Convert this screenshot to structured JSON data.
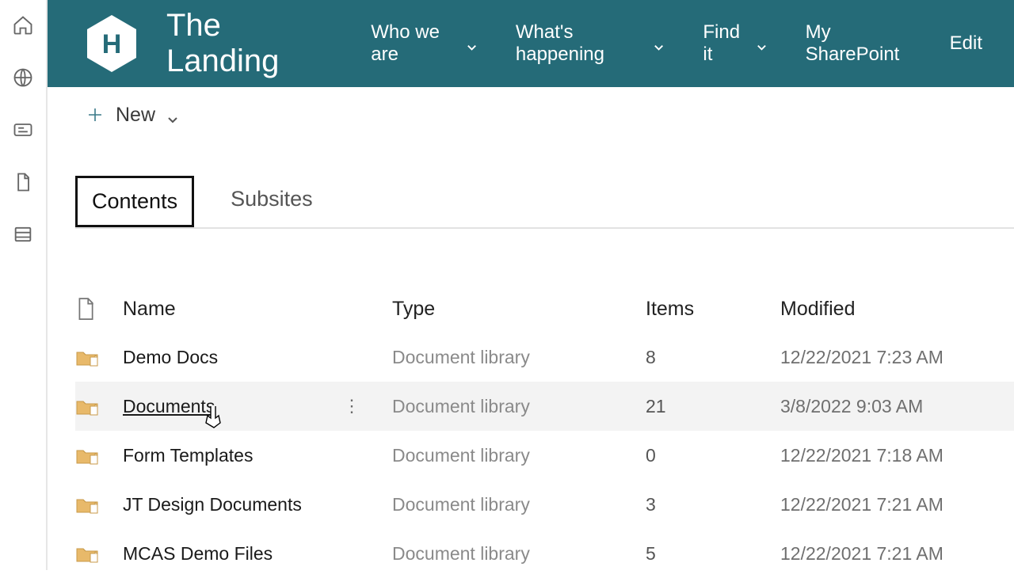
{
  "site": {
    "title": "The Landing"
  },
  "nav": {
    "items": [
      {
        "label": "Who we are",
        "has_dropdown": true
      },
      {
        "label": "What's happening",
        "has_dropdown": true
      },
      {
        "label": "Find it",
        "has_dropdown": true
      },
      {
        "label": "My SharePoint",
        "has_dropdown": false
      },
      {
        "label": "Edit",
        "has_dropdown": false
      }
    ]
  },
  "command_bar": {
    "new_label": "New"
  },
  "tabs": {
    "items": [
      {
        "label": "Contents",
        "active": true
      },
      {
        "label": "Subsites",
        "active": false
      }
    ]
  },
  "table": {
    "columns": {
      "name": "Name",
      "type": "Type",
      "items": "Items",
      "modified": "Modified"
    },
    "rows": [
      {
        "name": "Demo Docs",
        "type": "Document library",
        "items": "8",
        "modified": "12/22/2021 7:23 AM",
        "hover": false
      },
      {
        "name": "Documents",
        "type": "Document library",
        "items": "21",
        "modified": "3/8/2022 9:03 AM",
        "hover": true
      },
      {
        "name": "Form Templates",
        "type": "Document library",
        "items": "0",
        "modified": "12/22/2021 7:18 AM",
        "hover": false
      },
      {
        "name": "JT Design Documents",
        "type": "Document library",
        "items": "3",
        "modified": "12/22/2021 7:21 AM",
        "hover": false
      },
      {
        "name": "MCAS Demo Files",
        "type": "Document library",
        "items": "5",
        "modified": "12/22/2021 7:21 AM",
        "hover": false
      }
    ]
  },
  "colors": {
    "header_bg": "#256b78"
  }
}
